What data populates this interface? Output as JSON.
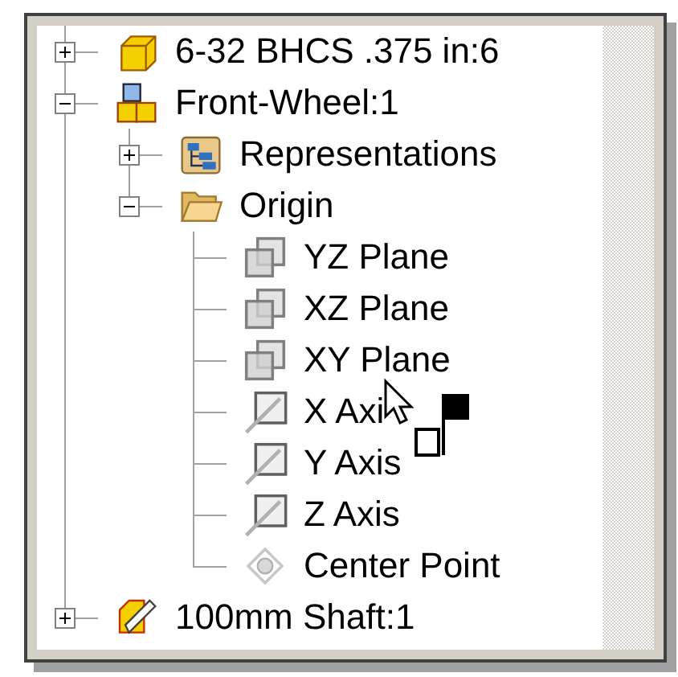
{
  "tree": [
    {
      "label": "6-32 BHCS .375 in:6",
      "kind": "part",
      "expanded": false
    },
    {
      "label": "Front-Wheel:1",
      "kind": "assembly",
      "expanded": true,
      "children": [
        {
          "label": "Representations",
          "kind": "representations",
          "expanded": false
        },
        {
          "label": "Origin",
          "kind": "folder",
          "expanded": true,
          "children": [
            {
              "label": "YZ Plane",
              "kind": "plane"
            },
            {
              "label": "XZ Plane",
              "kind": "plane"
            },
            {
              "label": "XY Plane",
              "kind": "plane"
            },
            {
              "label": "X Axi",
              "kind": "axis"
            },
            {
              "label": "Y Axis",
              "kind": "axis"
            },
            {
              "label": "Z Axis",
              "kind": "axis"
            },
            {
              "label": "Center Point",
              "kind": "point"
            }
          ]
        }
      ]
    },
    {
      "label": "100mm Shaft:1",
      "kind": "shaft",
      "expanded": false
    }
  ]
}
